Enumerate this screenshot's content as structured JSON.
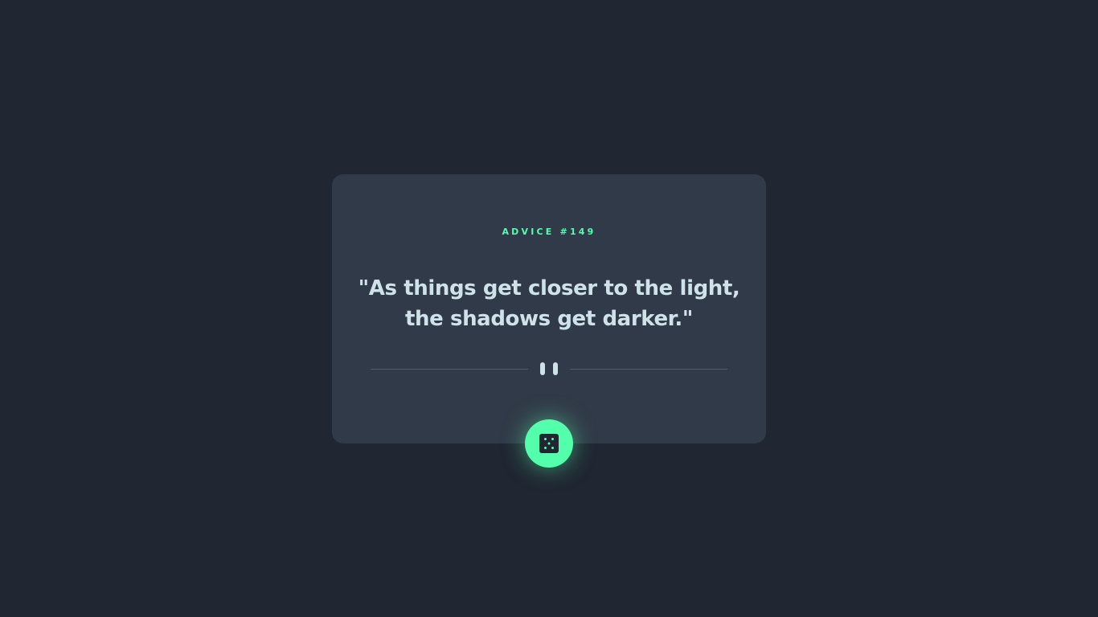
{
  "advice": {
    "label": "ADVICE #149",
    "quote": "\"As things get closer to the light, the shadows get darker.\""
  },
  "colors": {
    "background": "#202632",
    "card": "#313a48",
    "accent": "#53ffaa",
    "text": "#cee3e9",
    "divider": "#4f5d74"
  },
  "icons": {
    "divider": "pause-icon",
    "button": "dice-icon"
  }
}
